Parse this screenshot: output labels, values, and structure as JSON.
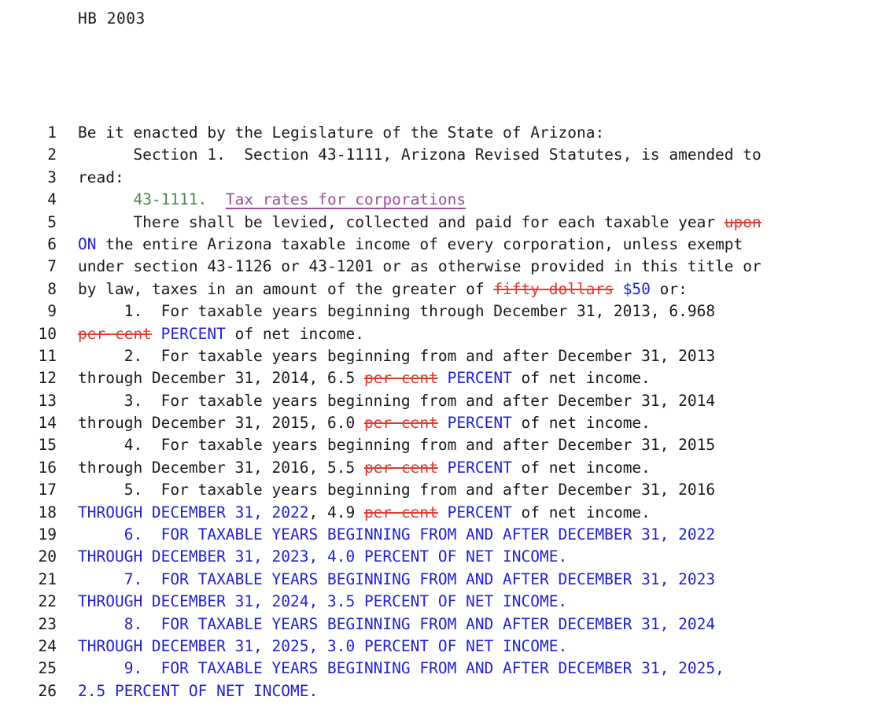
{
  "document": {
    "bill_header": "HB 2003",
    "jurisdiction_note": "Arizona legislative bill redline",
    "legend": {
      "deleted_color": "#e03a30",
      "inserted_color": "#2222cc",
      "section_number_color": "#4a8a4a",
      "section_heading_color": "#9b4f96",
      "body_color": "#1a1a1a"
    }
  },
  "lines": [
    {
      "number": "1",
      "tokens": [
        {
          "style": "plain",
          "text": "Be it enacted by the Legislature of the State of Arizona:"
        }
      ]
    },
    {
      "number": "2",
      "tokens": [
        {
          "style": "plain",
          "text": "      Section 1.  Section 43-1111, Arizona Revised Statutes, is amended to"
        }
      ]
    },
    {
      "number": "3",
      "tokens": [
        {
          "style": "plain",
          "text": "read:"
        }
      ]
    },
    {
      "number": "4",
      "tokens": [
        {
          "style": "plain",
          "text": "      "
        },
        {
          "style": "sect",
          "text": "43-1111."
        },
        {
          "style": "plain",
          "text": "  "
        },
        {
          "style": "head",
          "text": "Tax rates for corporations"
        }
      ]
    },
    {
      "number": "5",
      "tokens": [
        {
          "style": "plain",
          "text": "      There shall be levied, collected and paid for each taxable year "
        },
        {
          "style": "del",
          "text": "upon"
        }
      ]
    },
    {
      "number": "6",
      "tokens": [
        {
          "style": "ins",
          "text": "ON"
        },
        {
          "style": "plain",
          "text": " the entire Arizona taxable income of every corporation, unless exempt"
        }
      ]
    },
    {
      "number": "7",
      "tokens": [
        {
          "style": "plain",
          "text": "under section 43-1126 or 43-1201 or as otherwise provided in this title or"
        }
      ]
    },
    {
      "number": "8",
      "tokens": [
        {
          "style": "plain",
          "text": "by law, taxes in an amount of the greater of "
        },
        {
          "style": "del",
          "text": "fifty dollars"
        },
        {
          "style": "plain",
          "text": " "
        },
        {
          "style": "ins",
          "text": "$50"
        },
        {
          "style": "plain",
          "text": " or:"
        }
      ]
    },
    {
      "number": "9",
      "tokens": [
        {
          "style": "plain",
          "text": "     1.  For taxable years beginning through December 31, 2013, 6.968"
        }
      ]
    },
    {
      "number": "10",
      "tokens": [
        {
          "style": "del",
          "text": "per cent"
        },
        {
          "style": "plain",
          "text": " "
        },
        {
          "style": "ins",
          "text": "PERCENT"
        },
        {
          "style": "plain",
          "text": " of net income."
        }
      ]
    },
    {
      "number": "11",
      "tokens": [
        {
          "style": "plain",
          "text": "     2.  For taxable years beginning from and after December 31, 2013"
        }
      ]
    },
    {
      "number": "12",
      "tokens": [
        {
          "style": "plain",
          "text": "through December 31, 2014, 6.5 "
        },
        {
          "style": "del",
          "text": "per cent"
        },
        {
          "style": "plain",
          "text": " "
        },
        {
          "style": "ins",
          "text": "PERCENT"
        },
        {
          "style": "plain",
          "text": " of net income."
        }
      ]
    },
    {
      "number": "13",
      "tokens": [
        {
          "style": "plain",
          "text": "     3.  For taxable years beginning from and after December 31, 2014"
        }
      ]
    },
    {
      "number": "14",
      "tokens": [
        {
          "style": "plain",
          "text": "through December 31, 2015, 6.0 "
        },
        {
          "style": "del",
          "text": "per cent"
        },
        {
          "style": "plain",
          "text": " "
        },
        {
          "style": "ins",
          "text": "PERCENT"
        },
        {
          "style": "plain",
          "text": " of net income."
        }
      ]
    },
    {
      "number": "15",
      "tokens": [
        {
          "style": "plain",
          "text": "     4.  For taxable years beginning from and after December 31, 2015"
        }
      ]
    },
    {
      "number": "16",
      "tokens": [
        {
          "style": "plain",
          "text": "through December 31, 2016, 5.5 "
        },
        {
          "style": "del",
          "text": "per cent"
        },
        {
          "style": "plain",
          "text": " "
        },
        {
          "style": "ins",
          "text": "PERCENT"
        },
        {
          "style": "plain",
          "text": " of net income."
        }
      ]
    },
    {
      "number": "17",
      "tokens": [
        {
          "style": "plain",
          "text": "     5.  For taxable years beginning from and after December 31, 2016"
        }
      ]
    },
    {
      "number": "18",
      "tokens": [
        {
          "style": "ins",
          "text": "THROUGH DECEMBER 31, 2022"
        },
        {
          "style": "plain",
          "text": ", 4.9 "
        },
        {
          "style": "del",
          "text": "per cent"
        },
        {
          "style": "plain",
          "text": " "
        },
        {
          "style": "ins",
          "text": "PERCENT"
        },
        {
          "style": "plain",
          "text": " of net income."
        }
      ]
    },
    {
      "number": "19",
      "tokens": [
        {
          "style": "ins",
          "text": "     6.  FOR TAXABLE YEARS BEGINNING FROM AND AFTER DECEMBER 31, 2022"
        }
      ]
    },
    {
      "number": "20",
      "tokens": [
        {
          "style": "ins",
          "text": "THROUGH DECEMBER 31, 2023, 4.0 PERCENT OF NET INCOME."
        }
      ]
    },
    {
      "number": "21",
      "tokens": [
        {
          "style": "ins",
          "text": "     7.  FOR TAXABLE YEARS BEGINNING FROM AND AFTER DECEMBER 31, 2023"
        }
      ]
    },
    {
      "number": "22",
      "tokens": [
        {
          "style": "ins",
          "text": "THROUGH DECEMBER 31, 2024, 3.5 PERCENT OF NET INCOME."
        }
      ]
    },
    {
      "number": "23",
      "tokens": [
        {
          "style": "ins",
          "text": "     8.  FOR TAXABLE YEARS BEGINNING FROM AND AFTER DECEMBER 31, 2024"
        }
      ]
    },
    {
      "number": "24",
      "tokens": [
        {
          "style": "ins",
          "text": "THROUGH DECEMBER 31, 2025, 3.0 PERCENT OF NET INCOME."
        }
      ]
    },
    {
      "number": "25",
      "tokens": [
        {
          "style": "ins",
          "text": "     9.  FOR TAXABLE YEARS BEGINNING FROM AND AFTER DECEMBER 31, 2025,"
        }
      ]
    },
    {
      "number": "26",
      "tokens": [
        {
          "style": "ins",
          "text": "2.5 PERCENT OF NET INCOME."
        }
      ]
    }
  ]
}
